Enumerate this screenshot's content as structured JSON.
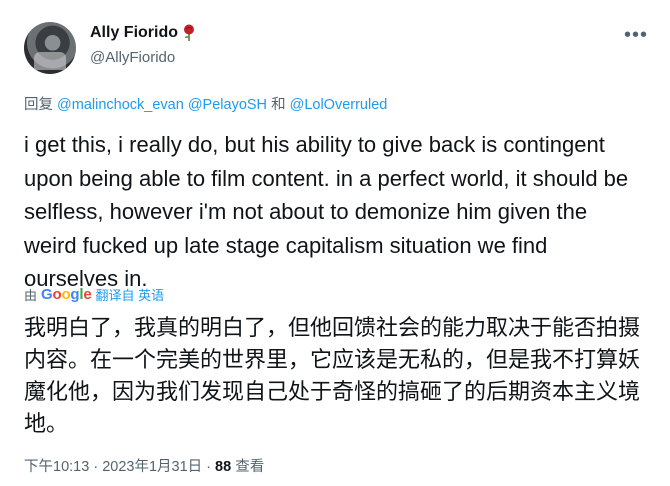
{
  "author": {
    "display_name": "Ally Fiorido",
    "handle": "@AllyFiorido"
  },
  "icons": {
    "name_badge": "rose-emoji-icon",
    "more": "more-options-icon",
    "avatar": "profile-photo"
  },
  "reply": {
    "prefix": "回复",
    "mention1": "@malinchock_evan",
    "mention2": "@PelayoSH",
    "conjunction": "和",
    "mention3": "@LolOverruled"
  },
  "tweet": {
    "text": "i get this, i really do, but his ability to give back is contingent upon being able to film content. in a perfect world, it should be selfless, however i'm not about to demonize him given the weird fucked up late stage capitalism situation we find ourselves in."
  },
  "translation": {
    "by": "由",
    "provider": "Google",
    "action": "翻译自",
    "language": "英语",
    "text": "我明白了，我真的明白了，但他回馈社会的能力取决于能否拍摄内容。在一个完美的世界里，它应该是无私的，但是我不打算妖魔化他，因为我们发现自己处于奇怪的搞砸了的后期资本主义境地。"
  },
  "meta": {
    "time": "下午10:13",
    "separator": " · ",
    "date": "2023年1月31日",
    "views_count": "88",
    "views_label": "查看"
  },
  "colors": {
    "link": "#1d9bf0",
    "secondary": "#536471",
    "primary": "#0f1419"
  }
}
